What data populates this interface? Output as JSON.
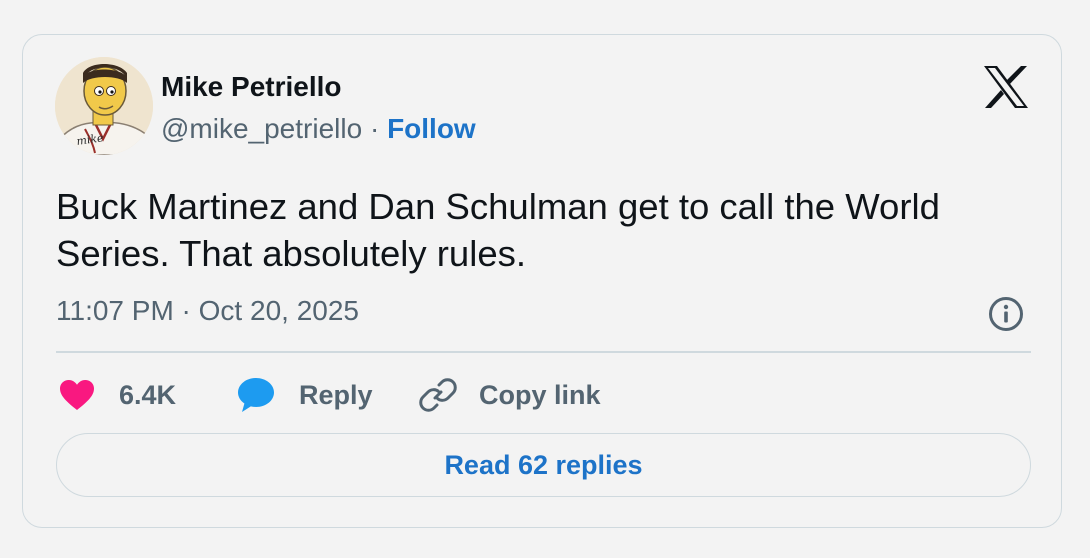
{
  "author": {
    "name": "Mike Petriello",
    "handle": "@mike_petriello",
    "separator": " · ",
    "follow_label": "Follow",
    "avatar_signature": "mike"
  },
  "tweet": {
    "text": "Buck Martinez and Dan Schulman get to call the World Series. That absolutely rules.",
    "timestamp": "11:07 PM · Oct 20, 2025"
  },
  "actions": {
    "likes_count": "6.4K",
    "reply_label": "Reply",
    "copy_link_label": "Copy link"
  },
  "read_replies_label": "Read 62 replies",
  "icons": {
    "brand": "x-logo-icon",
    "info": "info-icon",
    "like": "heart-icon",
    "reply": "speech-bubble-icon",
    "copy": "link-icon"
  },
  "colors": {
    "accent": "#1d73c8",
    "like": "#f91880",
    "reply": "#1d9bf0",
    "text_primary": "#0f1419",
    "text_secondary": "#536471",
    "border": "#cfd9de",
    "background": "#f3f3f3"
  }
}
